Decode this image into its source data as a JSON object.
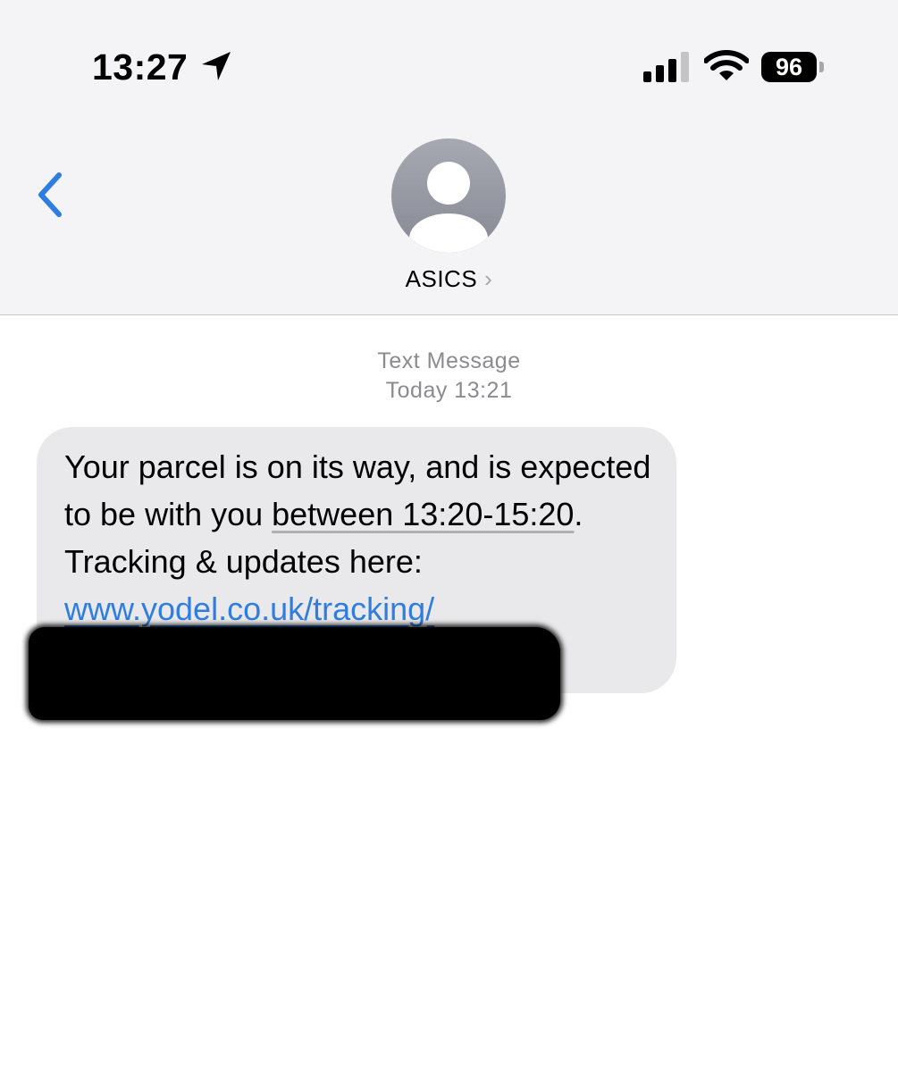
{
  "status_bar": {
    "time": "13:27",
    "battery": "96",
    "location_icon": "location-arrow-icon",
    "signal_icon": "cellular-signal-icon",
    "wifi_icon": "wifi-icon"
  },
  "nav": {
    "back_icon": "chevron-left-icon",
    "contact_name": "ASICS",
    "contact_chevron": "›",
    "avatar_icon": "person-icon"
  },
  "conversation": {
    "meta_label": "Text Message",
    "meta_time": "Today 13:21",
    "message": {
      "part1": "Your parcel is on its way, and is expected to be with you ",
      "highlight": "between 13:20-15:20",
      "part2": ". Tracking & updates here: ",
      "link": "www.yodel.co.uk/tracking/"
    }
  },
  "colors": {
    "header_bg": "#f4f4f6",
    "accent_blue": "#2f7de1",
    "bubble_bg": "#e9e9eb",
    "meta_gray": "#8b8b90"
  }
}
